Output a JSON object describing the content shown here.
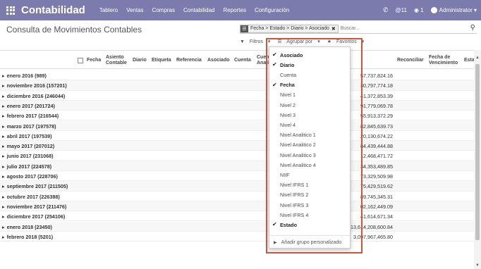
{
  "navbar": {
    "brand": "Contabilidad",
    "menu": [
      "Tablero",
      "Ventas",
      "Compras",
      "Contabilidad",
      "Reportes",
      "Configuración"
    ],
    "messages_count": "@11",
    "chat_count": "1",
    "user": "Administrator",
    "bg_color": "#7c7bad"
  },
  "control_panel": {
    "title": "Consulta de Movimientos Contables",
    "facet": "Fecha > Estado > Diario > Asociado",
    "search_placeholder": "Buscar...",
    "filters_label": "Filtros",
    "group_by_label": "Agrupar por",
    "favorites_label": "Favoritos"
  },
  "table": {
    "headers": {
      "fecha": "Fecha",
      "asiento": "Asiento Contable",
      "diario": "Diario",
      "etiqueta": "Etiqueta",
      "referencia": "Referencia",
      "asociado": "Asociado",
      "cuenta": "Cuenta",
      "cuenta_analitica": "Cuenta Analítica",
      "reconciliar": "Reconciliar",
      "fecha_vencimiento": "Fecha de Vencimiento",
      "estado": "Esta"
    },
    "rows": [
      {
        "label": "enero 2016 (989)",
        "v1": "",
        "v2": "57,737,824.16"
      },
      {
        "label": "noviembre 2016 (157201)",
        "v1": "",
        "v2": "30,797,774.18"
      },
      {
        "label": "diciembre 2016 (246044)",
        "v1": "",
        "v2": "41,372,853.39"
      },
      {
        "label": "enero 2017 (201724)",
        "v1": "",
        "v2": "91,779,069.78"
      },
      {
        "label": "febrero 2017 (216544)",
        "v1": "",
        "v2": "55,913,372.29"
      },
      {
        "label": "marzo 2017 (197578)",
        "v1": "",
        "v2": "82,845,639.73"
      },
      {
        "label": "abril 2017 (197539)",
        "v1": "",
        "v2": "20,130,674.22"
      },
      {
        "label": "mayo 2017 (207012)",
        "v1": "",
        "v2": "84,439,444.88"
      },
      {
        "label": "junio 2017 (231068)",
        "v1": "",
        "v2": "12,468,471.72"
      },
      {
        "label": "julio 2017 (224578)",
        "v1": "",
        "v2": "34,353,489.85"
      },
      {
        "label": "agosto 2017 (228706)",
        "v1": "",
        "v2": "73,329,509.98"
      },
      {
        "label": "septiembre 2017 (211505)",
        "v1": "",
        "v2": "75,429,519.62"
      },
      {
        "label": "octubre 2017 (226388)",
        "v1": "",
        "v2": "89,745,345.31"
      },
      {
        "label": "noviembre 2017 (211476)",
        "v1": "",
        "v2": "02,162,449.09"
      },
      {
        "label": "diciembre 2017 (254106)",
        "v1": "",
        "v2": "41,614,671.34"
      },
      {
        "label": "enero 2018 (23450)",
        "v1": "13,614,208,600.84",
        "v2": "13,614,208,600.84"
      },
      {
        "label": "febrero 2018 (5201)",
        "v1": "3,097,967,465.80",
        "v2": "3,097,967,465.80"
      }
    ]
  },
  "group_by_menu": {
    "items": [
      {
        "label": "Asociado",
        "selected": true
      },
      {
        "label": "Diario",
        "selected": true
      },
      {
        "label": "Cuenta",
        "selected": false
      },
      {
        "label": "Fecha",
        "selected": true
      },
      {
        "label": "Nivel 1",
        "selected": false
      },
      {
        "label": "Nivel 2",
        "selected": false
      },
      {
        "label": "Nivel 3",
        "selected": false
      },
      {
        "label": "Nivel 4",
        "selected": false
      },
      {
        "label": "Nivel Analitico 1",
        "selected": false
      },
      {
        "label": "Nivel Analitico 2",
        "selected": false
      },
      {
        "label": "Nivel Analitico 3",
        "selected": false
      },
      {
        "label": "Nivel Analitico 4",
        "selected": false
      },
      {
        "label": "NIIF",
        "selected": false
      },
      {
        "label": "Nivel IFRS 1",
        "selected": false
      },
      {
        "label": "Nivel IFRS 2",
        "selected": false
      },
      {
        "label": "Nivel IFRS 3",
        "selected": false
      },
      {
        "label": "Nivel IFRS 4",
        "selected": false
      },
      {
        "label": "Estado",
        "selected": true
      }
    ],
    "add_custom_group": "Añadir grupo personalizado",
    "highlight_color": "#d1533a"
  }
}
